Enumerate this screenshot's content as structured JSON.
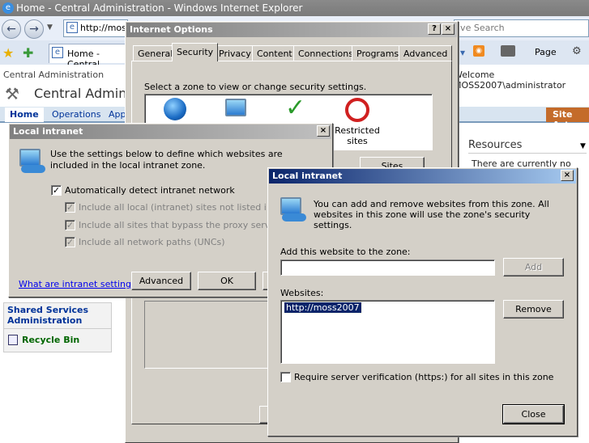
{
  "browser": {
    "title": "Home - Central Administration - Windows Internet Explorer",
    "address": "http://moss",
    "search_placeholder": "ive Search",
    "tab_label": "Home - Central",
    "page_menu": "Page",
    "tools_menu": "T"
  },
  "sharepoint": {
    "breadcrumb": "Central Administration",
    "welcome": "Welcome MOSS2007\\administrator",
    "site_title": "Central Admin",
    "nav": {
      "home": "Home",
      "operations": "Operations",
      "app": "App"
    },
    "site_actions": "Site Act",
    "resources_title": "Resources",
    "resources_text": "There are currently no",
    "shared_services": "Shared Services Administration",
    "recycle_bin": "Recycle Bin"
  },
  "internet_options": {
    "title": "Internet Options",
    "tabs": [
      "General",
      "Security",
      "Privacy",
      "Content",
      "Connections",
      "Programs",
      "Advanced"
    ],
    "zone_prompt": "Select a zone to view or change security settings.",
    "zone_restricted": "Restricted sites",
    "sites_button": "Sites"
  },
  "local_intranet_1": {
    "title": "Local intranet",
    "description": "Use the settings below to define which websites are included in the local intranet zone.",
    "auto_detect": {
      "label": "Automatically detect intranet network",
      "checked": true
    },
    "options": [
      {
        "label": "Include all local (intranet) sites not listed in other",
        "checked": true,
        "disabled": true
      },
      {
        "label": "Include all sites that bypass the proxy server",
        "checked": true,
        "disabled": true
      },
      {
        "label": "Include all network paths (UNCs)",
        "checked": true,
        "disabled": true
      }
    ],
    "help_link": "What are intranet settings?",
    "advanced_button": "Advanced",
    "ok_button": "OK"
  },
  "local_intranet_2": {
    "title": "Local intranet",
    "description": "You can add and remove websites from this zone. All websites in this zone will use the zone's security settings.",
    "add_label": "Add this website to the zone:",
    "add_value": "",
    "add_button": "Add",
    "websites_label": "Websites:",
    "websites": [
      "http://moss2007"
    ],
    "remove_button": "Remove",
    "require_https": {
      "label": "Require server verification (https:) for all sites in this zone",
      "checked": false
    },
    "close_button": "Close"
  }
}
